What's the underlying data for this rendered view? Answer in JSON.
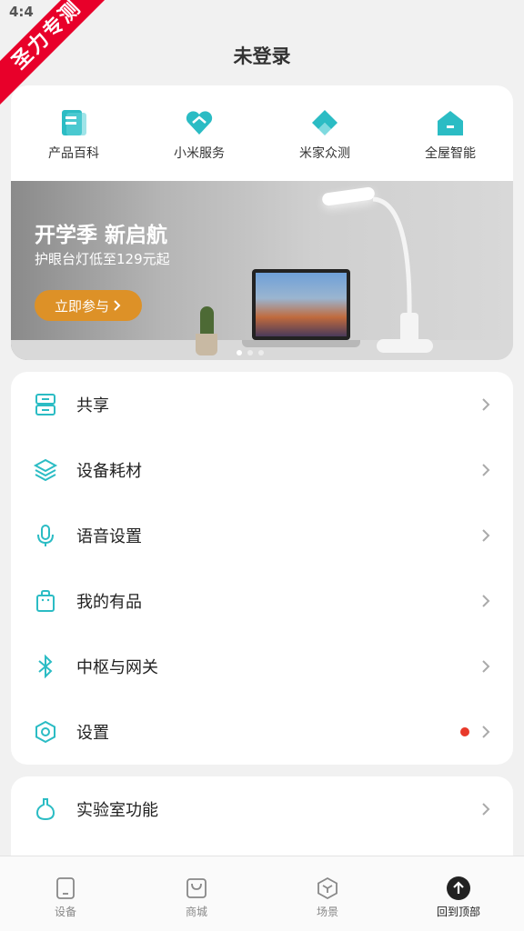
{
  "status": {
    "time": "4:4"
  },
  "ribbon": {
    "text": "圣力专测"
  },
  "header": {
    "title": "未登录"
  },
  "quick_links": [
    {
      "label": "产品百科",
      "icon": "book-icon"
    },
    {
      "label": "小米服务",
      "icon": "heart-icon"
    },
    {
      "label": "米家众测",
      "icon": "diamond-icon"
    },
    {
      "label": "全屋智能",
      "icon": "home-icon"
    }
  ],
  "banner": {
    "title": "开学季 新启航",
    "subtitle": "护眼台灯低至129元起",
    "button": "立即参与",
    "slide_count": 3,
    "active_slide": 0
  },
  "menu": [
    {
      "label": "共享",
      "icon": "share-icon"
    },
    {
      "label": "设备耗材",
      "icon": "layers-icon"
    },
    {
      "label": "语音设置",
      "icon": "microphone-icon"
    },
    {
      "label": "我的有品",
      "icon": "shopping-bag-icon"
    },
    {
      "label": "中枢与网关",
      "icon": "bluetooth-icon"
    },
    {
      "label": "设置",
      "icon": "settings-hexagon-icon",
      "badge": true
    }
  ],
  "lab": {
    "label": "实验室功能",
    "icon": "flask-icon"
  },
  "tabs": [
    {
      "label": "设备",
      "icon": "device-icon"
    },
    {
      "label": "商城",
      "icon": "store-icon"
    },
    {
      "label": "场景",
      "icon": "cube-icon"
    },
    {
      "label": "回到顶部",
      "icon": "arrow-up-icon",
      "active": true
    }
  ],
  "colors": {
    "accent": "#2bbcc4",
    "banner_button": "#dd9127",
    "badge": "#e8392a",
    "ribbon": "#e8002a"
  }
}
